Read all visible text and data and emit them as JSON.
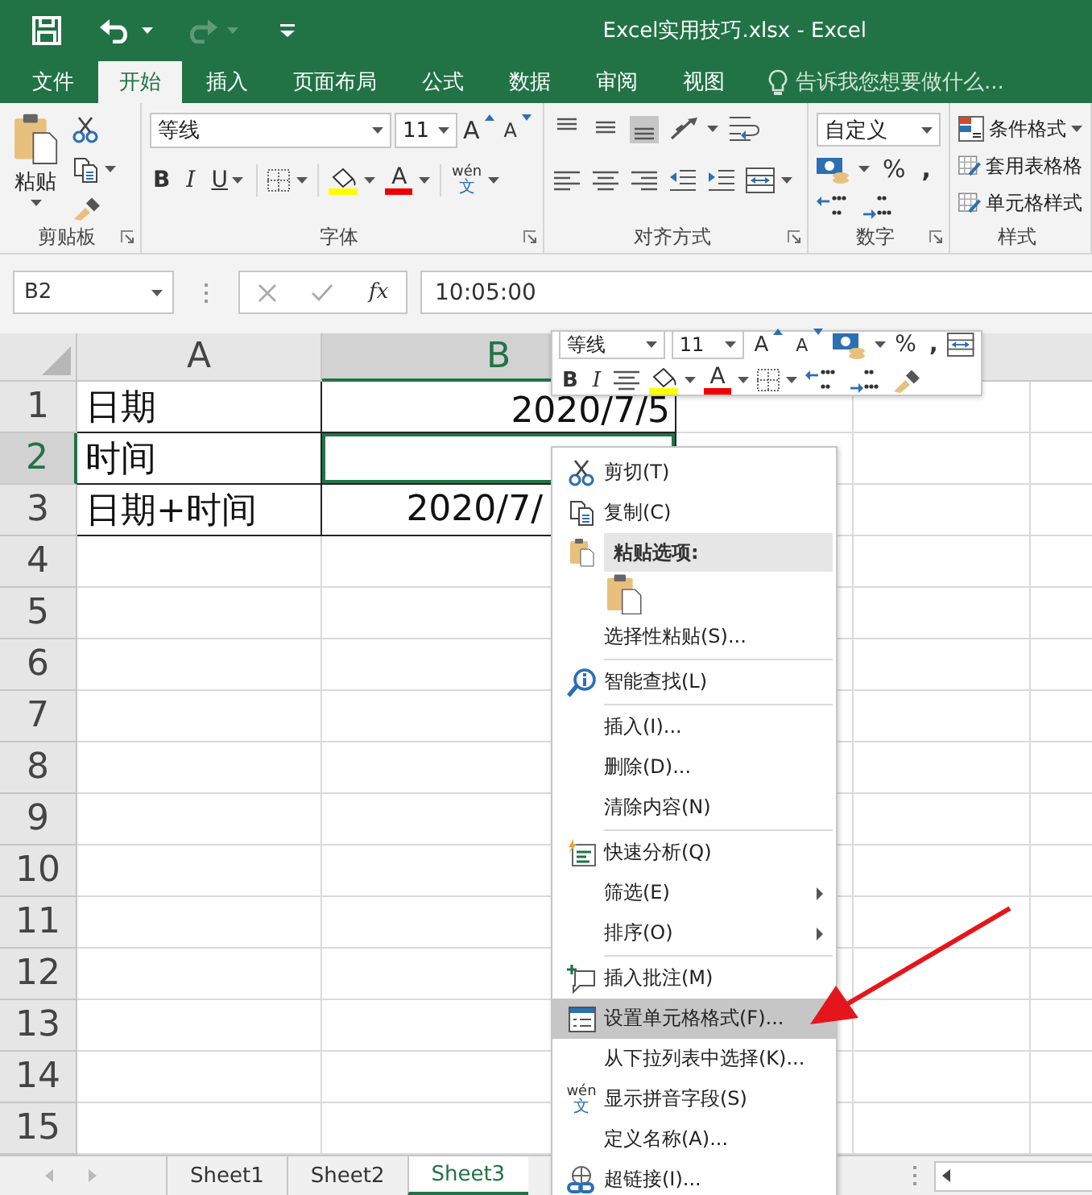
{
  "title_bar": {
    "title": "Excel实用技巧.xlsx - Excel"
  },
  "tabs": [
    {
      "label": "文件",
      "selected": false
    },
    {
      "label": "开始",
      "selected": true
    },
    {
      "label": "插入",
      "selected": false
    },
    {
      "label": "页面布局",
      "selected": false
    },
    {
      "label": "公式",
      "selected": false
    },
    {
      "label": "数据",
      "selected": false
    },
    {
      "label": "审阅",
      "selected": false
    },
    {
      "label": "视图",
      "selected": false
    }
  ],
  "tell_me": "告诉我您想要做什么...",
  "ribbon": {
    "clipboard": {
      "paste": "粘贴",
      "label": "剪贴板"
    },
    "font": {
      "name": "等线",
      "size": "11",
      "grow": "A",
      "shrink": "A",
      "bold": "B",
      "italic": "I",
      "underline": "U",
      "color_letter": "A",
      "phonetic": [
        "wén",
        "文"
      ],
      "label": "字体"
    },
    "alignment": {
      "vertical": [
        {
          "selected": false
        },
        {
          "selected": false
        },
        {
          "selected": true
        }
      ],
      "label": "对齐方式"
    },
    "number": {
      "format": "自定义",
      "percent": "%",
      "comma": ",",
      "label": "数字"
    },
    "styles": {
      "items": [
        "条件格式",
        "套用表格格",
        "单元格样式"
      ],
      "label": "样式"
    }
  },
  "formula_bar": {
    "name_box": "B2",
    "fx": "fx",
    "value": "10:05:00"
  },
  "sheet": {
    "columns": [
      {
        "label": "A",
        "selected": false
      },
      {
        "label": "B",
        "selected": true
      }
    ],
    "rows": [
      {
        "number": "1",
        "a": "日期",
        "b": "2020/7/5",
        "selected": false
      },
      {
        "number": "2",
        "a": "时间",
        "selected": true
      },
      {
        "number": "3",
        "a": "日期+时间",
        "b": "2020/7/",
        "selected": false
      },
      {
        "number": "4",
        "selected": false
      },
      {
        "number": "5",
        "selected": false
      },
      {
        "number": "6",
        "selected": false
      },
      {
        "number": "7",
        "selected": false
      },
      {
        "number": "8",
        "selected": false
      },
      {
        "number": "9",
        "selected": false
      },
      {
        "number": "10",
        "selected": false
      },
      {
        "number": "11",
        "selected": false
      },
      {
        "number": "12",
        "selected": false
      },
      {
        "number": "13",
        "selected": false
      },
      {
        "number": "14",
        "selected": false
      },
      {
        "number": "15",
        "selected": false
      }
    ]
  },
  "mini_toolbar": {
    "font": "等线",
    "size": "11",
    "grow": "A",
    "shrink": "A",
    "percent": "%",
    "comma": ",",
    "bold": "B",
    "italic": "I",
    "color_letter": "A"
  },
  "context_menu": {
    "items": [
      {
        "kind": "item",
        "label": "剪切(T)",
        "separator_before": false,
        "submenu": false,
        "selected": false
      },
      {
        "kind": "item",
        "label": "复制(C)",
        "separator_before": false,
        "submenu": false,
        "selected": false
      },
      {
        "kind": "header",
        "label": "粘贴选项:",
        "separator_before": false,
        "submenu": false,
        "selected": false
      },
      {
        "kind": "paste-choices",
        "separator_before": false,
        "submenu": false,
        "selected": false
      },
      {
        "kind": "item",
        "label": "选择性粘贴(S)...",
        "separator_before": false,
        "submenu": false,
        "selected": false
      },
      {
        "kind": "item",
        "label": "智能查找(L)",
        "separator_before": true,
        "submenu": false,
        "selected": false
      },
      {
        "kind": "item",
        "label": "插入(I)...",
        "separator_before": true,
        "submenu": false,
        "selected": false
      },
      {
        "kind": "item",
        "label": "删除(D)...",
        "separator_before": false,
        "submenu": false,
        "selected": false
      },
      {
        "kind": "item",
        "label": "清除内容(N)",
        "separator_before": false,
        "submenu": false,
        "selected": false
      },
      {
        "kind": "item",
        "label": "快速分析(Q)",
        "separator_before": true,
        "submenu": false,
        "selected": false
      },
      {
        "kind": "item",
        "label": "筛选(E)",
        "separator_before": false,
        "submenu": true,
        "selected": false
      },
      {
        "kind": "item",
        "label": "排序(O)",
        "separator_before": false,
        "submenu": true,
        "selected": false
      },
      {
        "kind": "item",
        "label": "插入批注(M)",
        "separator_before": true,
        "submenu": false,
        "selected": false
      },
      {
        "kind": "item",
        "label": "设置单元格格式(F)...",
        "separator_before": false,
        "submenu": false,
        "selected": true
      },
      {
        "kind": "item",
        "label": "从下拉列表中选择(K)...",
        "separator_before": false,
        "submenu": false,
        "selected": false
      },
      {
        "kind": "item",
        "label": "显示拼音字段(S)",
        "icon_text": [
          "wén",
          "文"
        ],
        "separator_before": false,
        "submenu": false,
        "selected": false
      },
      {
        "kind": "item",
        "label": "定义名称(A)...",
        "separator_before": false,
        "submenu": false,
        "selected": false
      },
      {
        "kind": "item",
        "label": "超链接(I)...",
        "separator_before": false,
        "submenu": false,
        "selected": false
      }
    ]
  },
  "sheet_tabs": [
    {
      "label": "Sheet1",
      "selected": false
    },
    {
      "label": "Sheet2",
      "selected": false
    },
    {
      "label": "Sheet3",
      "selected": true
    }
  ]
}
